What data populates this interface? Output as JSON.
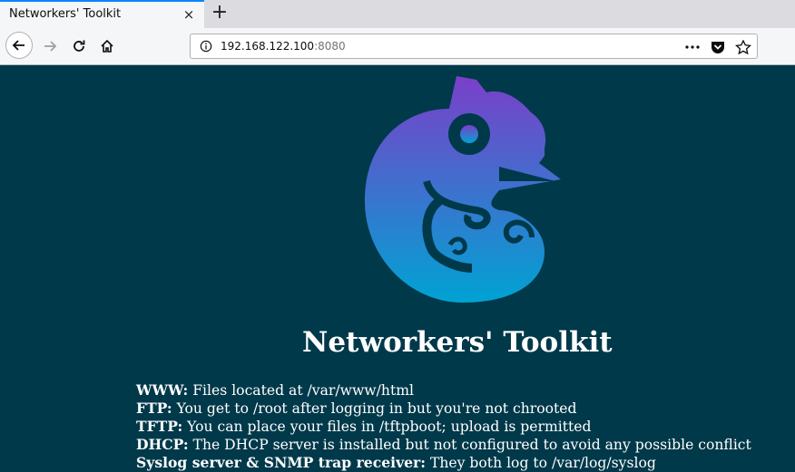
{
  "browser": {
    "tab_title": "Networkers' Toolkit",
    "tab_close_glyph": "×",
    "new_tab_glyph": "+",
    "url_host": "192.168.122.100",
    "url_port": ":8080",
    "accent": "#0a84ff",
    "icons": [
      "back-icon",
      "forward-icon",
      "reload-icon",
      "home-icon",
      "info-icon",
      "more-icon",
      "pocket-icon",
      "bookmark-star-icon"
    ]
  },
  "page": {
    "background": "#00394a",
    "title": "Networkers' Toolkit",
    "services": [
      {
        "label": "WWW:",
        "text": " Files located at /var/www/html"
      },
      {
        "label": "FTP:",
        "text": " You get to /root after logging in but you're not chrooted"
      },
      {
        "label": "TFTP:",
        "text": " You can place your files in /tftpboot; upload is permitted"
      },
      {
        "label": "DHCP:",
        "text": " The DHCP server is installed but not configured to avoid any possible conflict"
      },
      {
        "label": "Syslog server & SNMP trap receiver:",
        "text": " They both log to /var/log/syslog"
      }
    ],
    "logo_gradient": [
      "#7b3fc9",
      "#00a3d3"
    ]
  }
}
